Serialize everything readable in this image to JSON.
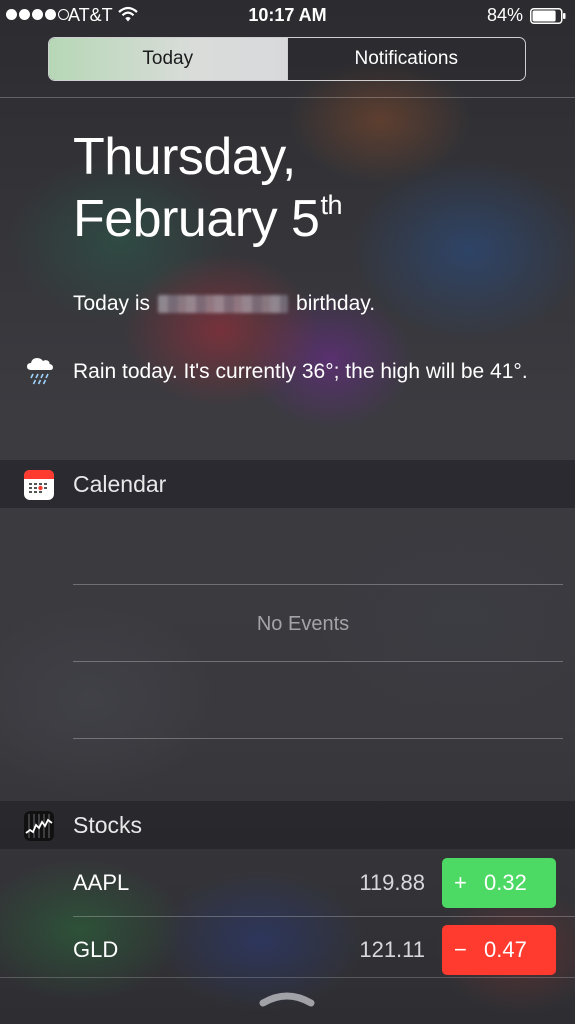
{
  "status_bar": {
    "carrier": "AT&T",
    "time": "10:17 AM",
    "battery": "84%",
    "battery_level": 0.84,
    "signal_bars": 4,
    "signal_max": 5,
    "icons": [
      "wifi-icon",
      "battery-icon"
    ]
  },
  "tabs": [
    {
      "label": "Today",
      "selected": true
    },
    {
      "label": "Notifications",
      "selected": false
    }
  ],
  "date": {
    "line1": "Thursday,",
    "line2": "February 5",
    "suffix": "th"
  },
  "birthday": {
    "prefix": "Today is",
    "suffix": "birthday."
  },
  "weather": {
    "icon": "rain-cloud-icon",
    "text": "Rain today. It's currently 36°; the high will be 41°."
  },
  "calendar": {
    "title": "Calendar",
    "icon": "calendar-app-icon",
    "empty_text": "No Events"
  },
  "stocks": {
    "title": "Stocks",
    "icon": "stocks-app-icon",
    "items": [
      {
        "symbol": "AAPL",
        "price": "119.88",
        "sign": "+",
        "change": "0.32",
        "color": "#4cd964"
      },
      {
        "symbol": "GLD",
        "price": "121.11",
        "sign": "−",
        "change": "0.47",
        "color": "#ff3b30"
      }
    ]
  },
  "colors": {
    "positive": "#4cd964",
    "negative": "#ff3b30",
    "selected_tab": "#d9d9dc"
  }
}
